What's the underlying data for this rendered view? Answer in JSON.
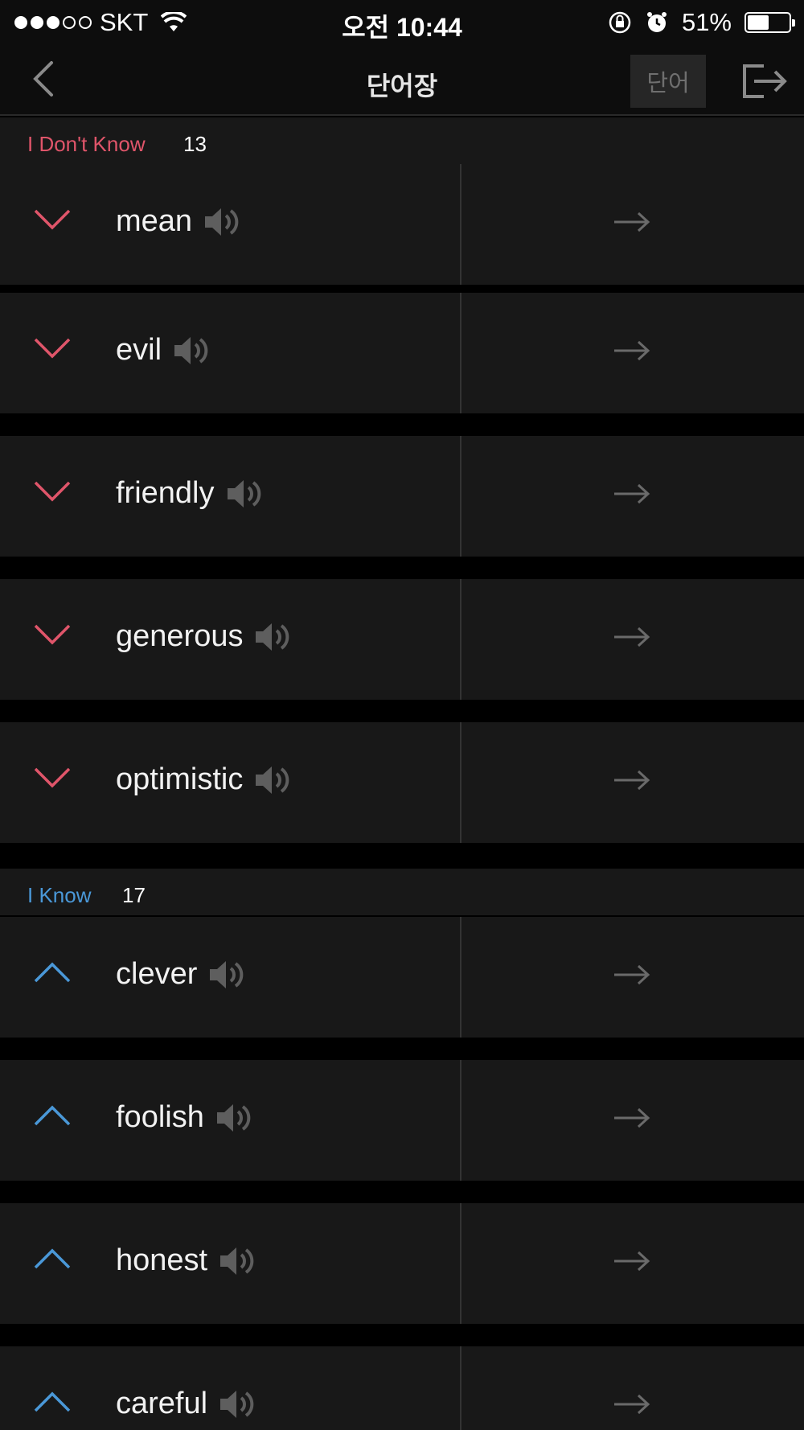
{
  "status_bar": {
    "carrier": "SKT",
    "time": "오전 10:44",
    "battery": "51%",
    "battery_level": 0.51
  },
  "nav": {
    "title": "단어장",
    "word_button": "단어",
    "icons": [
      "back-chevron-icon",
      "exit-icon"
    ]
  },
  "sections": [
    {
      "label": "I Don't Know",
      "count": "13",
      "color": "#e0556a",
      "words": [
        {
          "word": "mean"
        },
        {
          "word": "evil"
        },
        {
          "word": "friendly"
        },
        {
          "word": "generous"
        },
        {
          "word": "optimistic"
        }
      ]
    },
    {
      "label": "I Know",
      "count": "17",
      "color": "#4a98d8",
      "words": [
        {
          "word": "clever"
        },
        {
          "word": "foolish"
        },
        {
          "word": "honest"
        },
        {
          "word": "careful"
        }
      ]
    }
  ]
}
